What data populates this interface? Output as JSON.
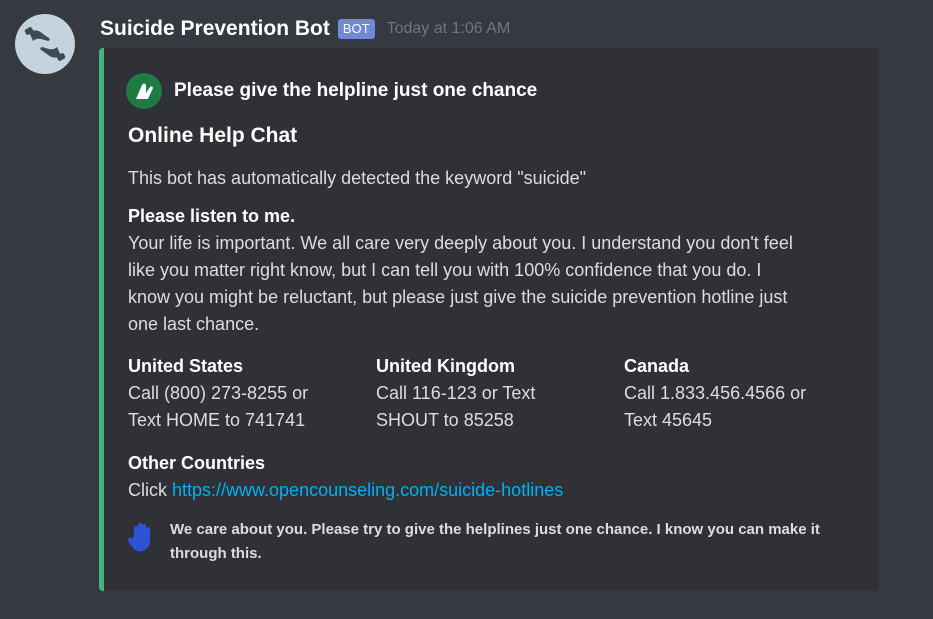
{
  "message": {
    "username": "Suicide Prevention Bot",
    "badge": "BOT",
    "timestamp": "Today at 1:06 AM",
    "avatar_icon": "helping-hands-icon"
  },
  "embed": {
    "accent_color": "#43b581",
    "author": {
      "name": "Please give the helpline just one chance",
      "icon": "helping-hand-icon"
    },
    "title": "Online Help Chat",
    "description": "This bot has automatically detected the keyword \"suicide\"",
    "fields": [
      {
        "name": "Please listen to me.",
        "value": "Your life is important. We all care very deeply about you. I understand you don't feel\nlike you matter right know, but I can tell you with 100% confidence that you do. I\nknow you might be reluctant, but please just give the suicide prevention hotline just\none last chance."
      },
      {
        "name": "United States",
        "value": "Call (800) 273-8255 or\nText HOME to 741741"
      },
      {
        "name": "United Kingdom",
        "value": "Call 116-123 or Text\nSHOUT to 85258"
      },
      {
        "name": "Canada",
        "value": "Call 1.833.456.4566 or\nText 45645"
      },
      {
        "name": "Other Countries",
        "value_prefix": "Click ",
        "link": "https://www.opencounseling.com/suicide-hotlines"
      }
    ],
    "footer": {
      "icon": "raised-hand-icon",
      "text": "We care about you. Please try to give the helplines just one chance. I know you can make it through this."
    }
  }
}
